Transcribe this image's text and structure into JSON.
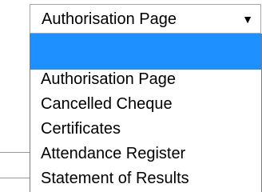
{
  "select": {
    "selected_label": "Authorisation Page",
    "arrow_icon": "triangle-down-icon"
  },
  "dropdown": {
    "highlighted_option": "",
    "options": [
      "Authorisation Page",
      "Cancelled Cheque",
      "Certificates",
      "Attendance Register",
      "Statement of Results"
    ]
  },
  "colors": {
    "highlight": "#1e90ff",
    "border": "#a6a6a6",
    "text": "#000000"
  }
}
